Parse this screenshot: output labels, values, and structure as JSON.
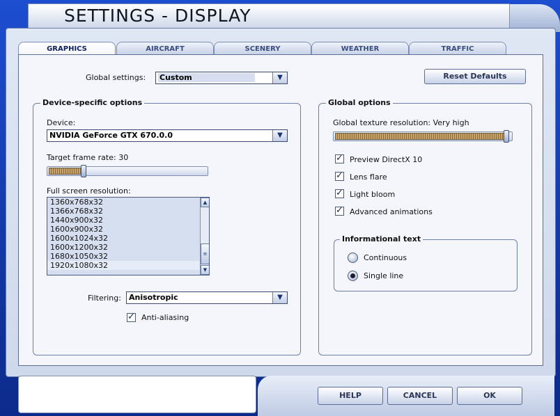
{
  "window": {
    "title": "SETTINGS - DISPLAY"
  },
  "tabs": [
    {
      "label": "GRAPHICS",
      "active": true
    },
    {
      "label": "AIRCRAFT",
      "active": false
    },
    {
      "label": "SCENERY",
      "active": false
    },
    {
      "label": "WEATHER",
      "active": false
    },
    {
      "label": "TRAFFIC",
      "active": false
    }
  ],
  "global_settings": {
    "label": "Global settings:",
    "value": "Custom"
  },
  "reset_defaults": {
    "label": "Reset Defaults"
  },
  "device_options": {
    "title": "Device-specific options",
    "device_label": "Device:",
    "device_value": "NVIDIA GeForce GTX 670.0.0",
    "frame_rate_label": "Target frame rate: 30",
    "frame_rate_fraction": 0.22,
    "resolution_label": "Full screen resolution:",
    "resolutions": [
      "1360x768x32",
      "1366x768x32",
      "1440x900x32",
      "1600x900x32",
      "1600x1024x32",
      "1600x1200x32",
      "1680x1050x32",
      "1920x1080x32"
    ],
    "selected_resolution": "1920x1080x32",
    "filtering_label": "Filtering:",
    "filtering_value": "Anisotropic",
    "anti_aliasing": {
      "label": "Anti-aliasing",
      "checked": true
    }
  },
  "global_options": {
    "title": "Global options",
    "texture_label": "Global texture resolution: Very high",
    "texture_fraction": 1.0,
    "checkboxes": [
      {
        "label": "Preview DirectX 10",
        "checked": true
      },
      {
        "label": "Lens flare",
        "checked": true
      },
      {
        "label": "Light bloom",
        "checked": true
      },
      {
        "label": "Advanced animations",
        "checked": true
      }
    ],
    "informational_text": {
      "title": "Informational text",
      "options": [
        {
          "label": "Continuous",
          "selected": false
        },
        {
          "label": "Single line",
          "selected": true
        }
      ]
    }
  },
  "footer": {
    "help": "HELP",
    "cancel": "CANCEL",
    "ok": "OK"
  }
}
